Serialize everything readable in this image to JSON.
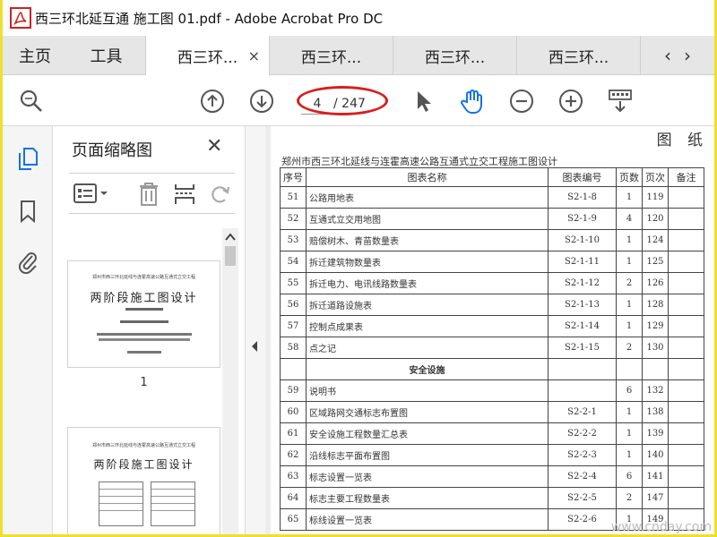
{
  "window": {
    "logo_glyph": "PDF",
    "title": "西三环北延互通 施工图 01.pdf - Adobe Acrobat Pro DC"
  },
  "tabs": {
    "home": "主页",
    "tools": "工具",
    "docs": [
      {
        "label": "西三环...",
        "active": true
      },
      {
        "label": "西三环...",
        "active": false
      },
      {
        "label": "西三环...",
        "active": false
      },
      {
        "label": "西三环...",
        "active": false
      }
    ],
    "close_glyph": "×",
    "prev_glyph": "‹",
    "next_glyph": "›"
  },
  "toolbar": {
    "current_page": "4",
    "total_pages": "/ 247"
  },
  "panel": {
    "title": "页面缩略图",
    "close_glyph": "✕",
    "thumbnails": [
      {
        "header": "郑州市西三环北延线与连霍高速公路互通式立交工程",
        "title": "两阶段施工图设计",
        "label": "1"
      },
      {
        "header": "郑州市西三环北延线与连霍高速公路互通式立交工程",
        "title": "两阶段施工图设计",
        "label": ""
      }
    ]
  },
  "document": {
    "corner_heading": "图 纸",
    "title": "郑州市西三环北延线与连霍高速公路互通式立交工程施工图设计",
    "columns": [
      "序号",
      "图表名称",
      "图表编号",
      "页数",
      "页次",
      "备注"
    ],
    "rows": [
      [
        "51",
        "公路用地表",
        "S2-1-8",
        "1",
        "119",
        ""
      ],
      [
        "52",
        "互通式立交用地图",
        "S2-1-9",
        "4",
        "120",
        ""
      ],
      [
        "53",
        "赔偿树木、青苗数量表",
        "S2-1-10",
        "1",
        "124",
        ""
      ],
      [
        "54",
        "拆迁建筑物数量表",
        "S2-1-11",
        "1",
        "125",
        ""
      ],
      [
        "55",
        "拆迁电力、电讯线路数量表",
        "S2-1-12",
        "2",
        "126",
        ""
      ],
      [
        "56",
        "拆迁道路设施表",
        "S2-1-13",
        "1",
        "128",
        ""
      ],
      [
        "57",
        "控制点成果表",
        "S2-1-14",
        "1",
        "129",
        ""
      ],
      [
        "58",
        "点之记",
        "S2-1-15",
        "2",
        "130",
        ""
      ],
      [
        "",
        "安全设施",
        "",
        "",
        "",
        ""
      ],
      [
        "59",
        "说明书",
        "",
        "6",
        "132",
        ""
      ],
      [
        "60",
        "区域路网交通标志布置图",
        "S2-2-1",
        "1",
        "138",
        ""
      ],
      [
        "61",
        "安全设施工程数量汇总表",
        "S2-2-2",
        "1",
        "139",
        ""
      ],
      [
        "62",
        "沿线标志平面布置图",
        "S2-2-3",
        "1",
        "140",
        ""
      ],
      [
        "63",
        "标志设置一览表",
        "S2-2-4",
        "6",
        "141",
        ""
      ],
      [
        "64",
        "标志主要工程数量表",
        "S2-2-5",
        "2",
        "147",
        ""
      ],
      [
        "65",
        "标线设置一览表",
        "S2-2-6",
        "1",
        "149",
        ""
      ]
    ],
    "watermark": "www.cnday.com"
  },
  "colors": {
    "accent_blue": "#1473e6",
    "annotation_red": "#d81e1e",
    "outer_border": "#f0df2a"
  }
}
